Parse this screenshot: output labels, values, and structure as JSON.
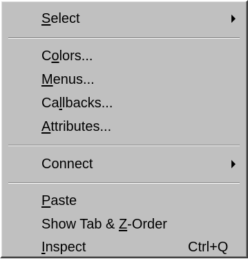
{
  "menu": {
    "items": [
      {
        "pre": "",
        "key": "S",
        "post": "elect",
        "submenu": true
      },
      {
        "pre": "C",
        "key": "o",
        "post": "lors..."
      },
      {
        "pre": "",
        "key": "M",
        "post": "enus..."
      },
      {
        "pre": "Ca",
        "key": "l",
        "post": "lbacks..."
      },
      {
        "pre": "",
        "key": "A",
        "post": "ttributes..."
      },
      {
        "pre": "Connect",
        "key": "",
        "post": "",
        "submenu": true
      },
      {
        "pre": "",
        "key": "P",
        "post": "aste"
      },
      {
        "pre": "Show Tab & ",
        "key": "Z",
        "post": "-Order"
      },
      {
        "pre": "",
        "key": "I",
        "post": "nspect",
        "shortcut": "Ctrl+Q"
      }
    ]
  }
}
